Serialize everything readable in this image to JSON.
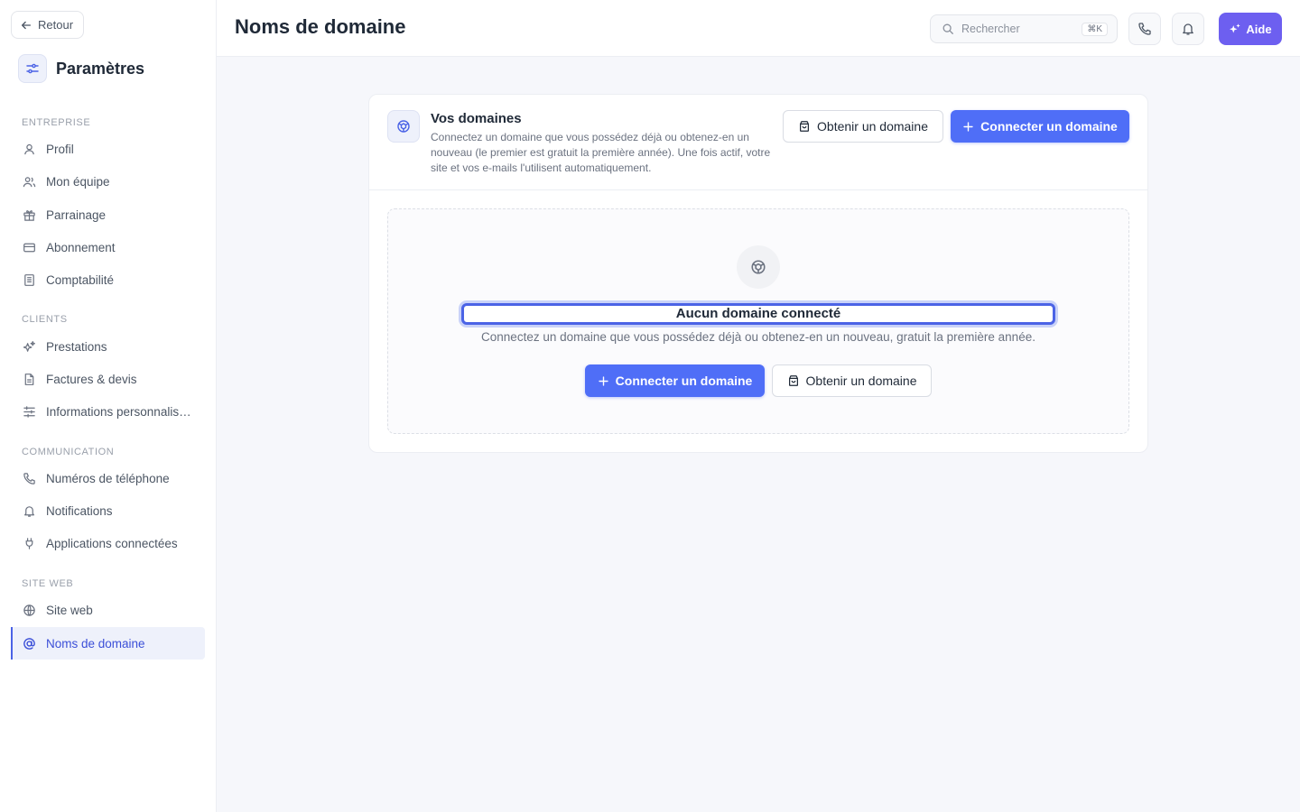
{
  "sidebar": {
    "back_label": "Retour",
    "title": "Paramètres",
    "sections": [
      {
        "label": "ENTREPRISE",
        "items": [
          {
            "label": "Profil",
            "icon": "user-icon"
          },
          {
            "label": "Mon équipe",
            "icon": "users-icon"
          },
          {
            "label": "Parrainage",
            "icon": "gift-icon"
          },
          {
            "label": "Abonnement",
            "icon": "credit-card-icon"
          },
          {
            "label": "Comptabilité",
            "icon": "ledger-icon"
          }
        ]
      },
      {
        "label": "CLIENTS",
        "items": [
          {
            "label": "Prestations",
            "icon": "sparkles-icon"
          },
          {
            "label": "Factures & devis",
            "icon": "document-icon"
          },
          {
            "label": "Informations personnalisées",
            "icon": "sliders-icon"
          }
        ]
      },
      {
        "label": "COMMUNICATION",
        "items": [
          {
            "label": "Numéros de téléphone",
            "icon": "phone-icon"
          },
          {
            "label": "Notifications",
            "icon": "bell-icon"
          },
          {
            "label": "Applications connectées",
            "icon": "plug-icon"
          }
        ]
      },
      {
        "label": "SITE WEB",
        "items": [
          {
            "label": "Site web",
            "icon": "globe-icon"
          },
          {
            "label": "Noms de domaine",
            "icon": "at-sign-icon",
            "active": true
          }
        ]
      }
    ]
  },
  "header": {
    "title": "Noms de domaine",
    "search_placeholder": "Rechercher",
    "search_shortcut": "⌘K",
    "help_label": "Aide"
  },
  "domains": {
    "title": "Vos domaines",
    "description": "Connectez un domaine que vous possédez déjà ou obtenez-en un nouveau (le premier est gratuit la première année). Une fois actif, votre site et vos e-mails l'utilisent automatiquement.",
    "get_domain_label": "Obtenir un domaine",
    "connect_domain_label": "Connecter un domaine",
    "empty_title": "Aucun domaine connecté",
    "empty_description": "Connectez un domaine que vous possédez déjà ou obtenez-en un nouveau, gratuit la première année."
  },
  "colors": {
    "accent": "#4f6ef7",
    "help_button": "#6d5ff0",
    "active_nav": "#3b4fd8"
  }
}
